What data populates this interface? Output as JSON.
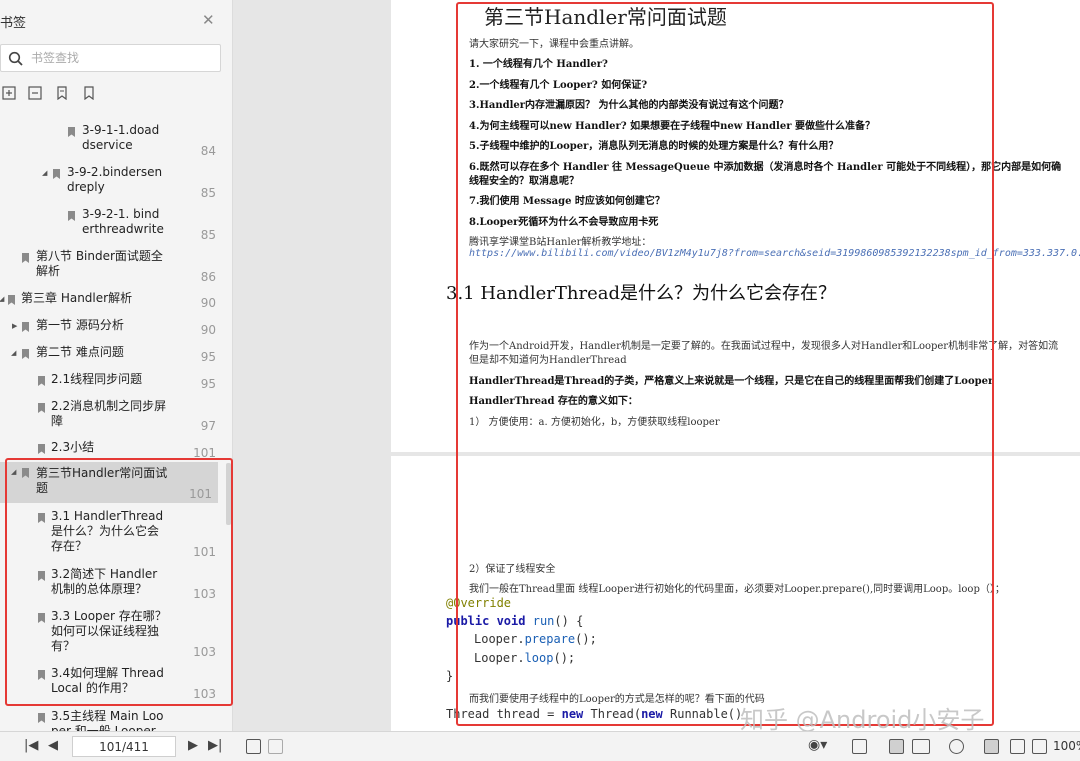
{
  "sidebar": {
    "title": "书签",
    "search_placeholder": "书签查找",
    "items": [
      {
        "label": "3-9-1-1.doad\ndservice",
        "page": "84"
      },
      {
        "label": "3-9-2.bindersen\ndreply",
        "page": "85"
      },
      {
        "label": "3-9-2-1. bind\nerthreadwrite",
        "page": "85"
      },
      {
        "label": "第八节 Binder面试题全\n解析",
        "page": "86"
      },
      {
        "label": "第三章 Handler解析",
        "page": "90"
      },
      {
        "label": "第一节 源码分析",
        "page": "90"
      },
      {
        "label": "第二节 难点问题",
        "page": "95"
      },
      {
        "label": "2.1线程同步问题",
        "page": "95"
      },
      {
        "label": "2.2消息机制之同步屏\n障",
        "page": "97"
      },
      {
        "label": "2.3小结",
        "page": "101"
      },
      {
        "label": "第三节Handler常问面试\n题",
        "page": "101"
      },
      {
        "label": "3.1 HandlerThread\n是什么？为什么它会\n存在？",
        "page": "101"
      },
      {
        "label": "3.2简述下 Handler\n机制的总体原理？",
        "page": "103"
      },
      {
        "label": "3.3 Looper 存在哪？\n如何可以保证线程独\n有？",
        "page": "103"
      },
      {
        "label": "3.4如何理解 Thread\nLocal 的作用？",
        "page": "103"
      },
      {
        "label": "3.5主线程 Main Loo\nper 和一般 Looper",
        "page": ""
      }
    ]
  },
  "document": {
    "title": "第三节Handler常问面试题",
    "intro": "请大家研究一下，课程中会重点讲解。",
    "questions": [
      "1. 一个线程有几个 Handler?",
      "2.一个线程有几个 Looper? 如何保证?",
      "3.Handler内存泄漏原因？ 为什么其他的内部类没有说过有这个问题？",
      "4.为何主线程可以new Handler? 如果想要在子线程中new Handler 要做些什么准备？",
      "5.子线程中维护的Looper，消息队列无消息的时候的处理方案是什么？有什么用？",
      "6.既然可以存在多个 Handler 往 MessageQueue 中添加数据（发消息时各个 Handler 可能处于不同线程），那它内部是如何确",
      "线程安全的？取消息呢？",
      "7.我们使用 Message 时应该如何创建它？",
      "8.Looper死循环为什么不会导致应用卡死"
    ],
    "video_label": "腾讯享学课堂B站Hanler解析教学地址：",
    "video_url": "https://www.bilibili.com/video/BV1zM4y1u7j8?from=search&seid=3199860985392132238spm_id_from=333.337.0.0",
    "section_heading": "3.1 HandlerThread是什么？为什么它会存在？",
    "para1_line1": "作为一个Android开发，Handler机制是一定要了解的。在我面试过程中，发现很多人对Handler和Looper机制非常了解，对答如流",
    "para1_line2": "但是却不知道何为HandlerThread",
    "para2": "HandlerThread是Thread的子类，严格意义上来说就是一个线程，只是它在自己的线程里面帮我们创建了Looper",
    "para3": "HandlerThread 存在的意义如下：",
    "point1": "1）  方便使用：a. 方便初始化，b，方便获取线程looper",
    "point2": "2）保证了线程安全",
    "para4": "我们一般在Thread里面 线程Looper进行初始化的代码里面，必须要对Looper.prepare(),同时要调用Loop。loop（）；",
    "code_override": "@Override",
    "code_public": "public",
    "code_void": " void ",
    "code_run": "run",
    "code_sig_rest": "() {",
    "code_looper1": "Looper.",
    "code_prepare": "prepare",
    "code_end1": "();",
    "code_looper2": "Looper.",
    "code_loop": "loop",
    "code_end2": "();",
    "code_close": "}",
    "para5": "而我们要使用子线程中的Looper的方式是怎样的呢？看下面的代码",
    "code_thread_decl": "Thread thread = ",
    "code_new": "new",
    "code_thread_rest": " Thread(",
    "code_new2": "new",
    "code_runnable": " Runnable()"
  },
  "watermark": "知乎 @Android小安子",
  "bottom_bar": {
    "page_value": "101/411",
    "zoom": "100%"
  },
  "colors": {
    "highlight_border": "#e53935",
    "link": "#4a6fb5",
    "keyword": "#1a1aa6"
  }
}
